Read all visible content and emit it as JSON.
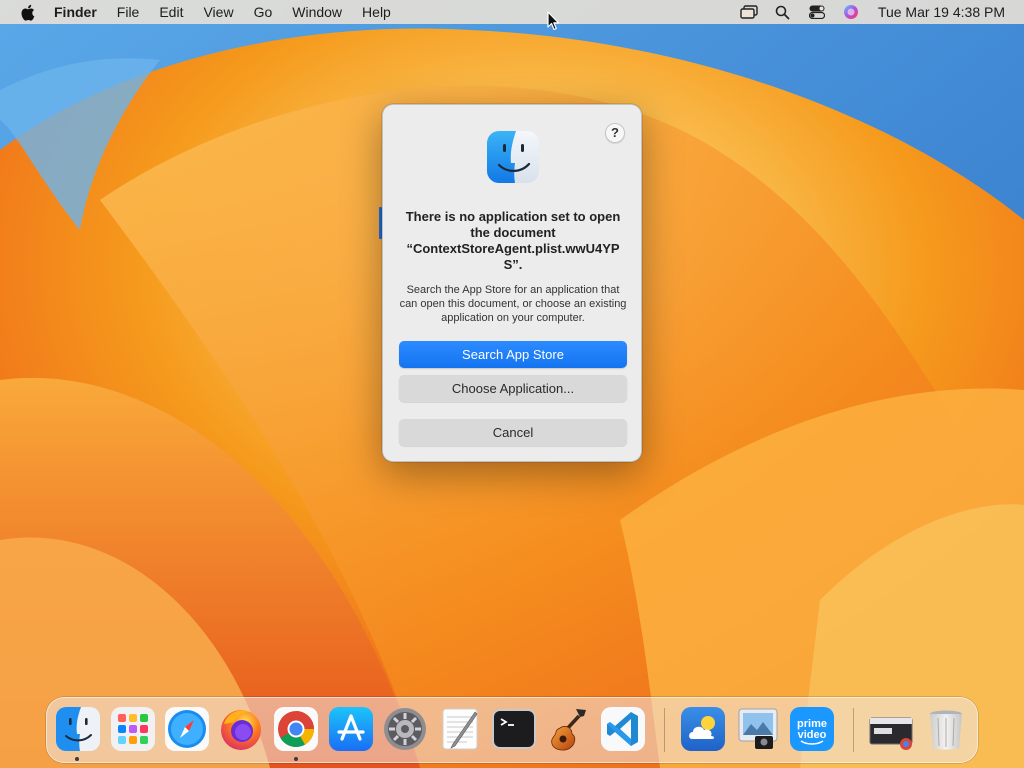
{
  "menubar": {
    "app_name": "Finder",
    "items": [
      "File",
      "Edit",
      "View",
      "Go",
      "Window",
      "Help"
    ],
    "clock": "Tue Mar 19  4:38 PM",
    "status_icons": [
      "screen-mirroring-icon",
      "spotlight-search-icon",
      "control-center-icon",
      "siri-icon"
    ]
  },
  "dialog": {
    "help_label": "?",
    "icon": "finder-icon",
    "title": "There is no application set to open the document “ContextStoreAgent.plist.wwU4YPS”.",
    "message": "Search the App Store for an application that can open this document, or choose an existing application on your computer.",
    "buttons": {
      "search": "Search App Store",
      "choose": "Choose Application...",
      "cancel": "Cancel"
    }
  },
  "dock": {
    "apps": [
      "finder-icon",
      "launchpad-icon",
      "safari-icon",
      "firefox-icon",
      "chrome-icon",
      "app-store-icon",
      "system-settings-icon",
      "textedit-icon",
      "terminal-icon",
      "garageband-icon",
      "vscode-icon"
    ],
    "running": [
      "finder-icon",
      "chrome-icon"
    ],
    "extras": [
      "weather-icon",
      "preview-icon",
      "prime-video-icon"
    ],
    "trash_section": [
      "downloads-stack-icon",
      "trash-icon"
    ],
    "prime_video_label": [
      "prime",
      "video"
    ]
  },
  "colors": {
    "accent": "#1474f0",
    "wallpaper_orange": "#f59a1c",
    "wallpaper_blue": "#3a7fd0"
  }
}
